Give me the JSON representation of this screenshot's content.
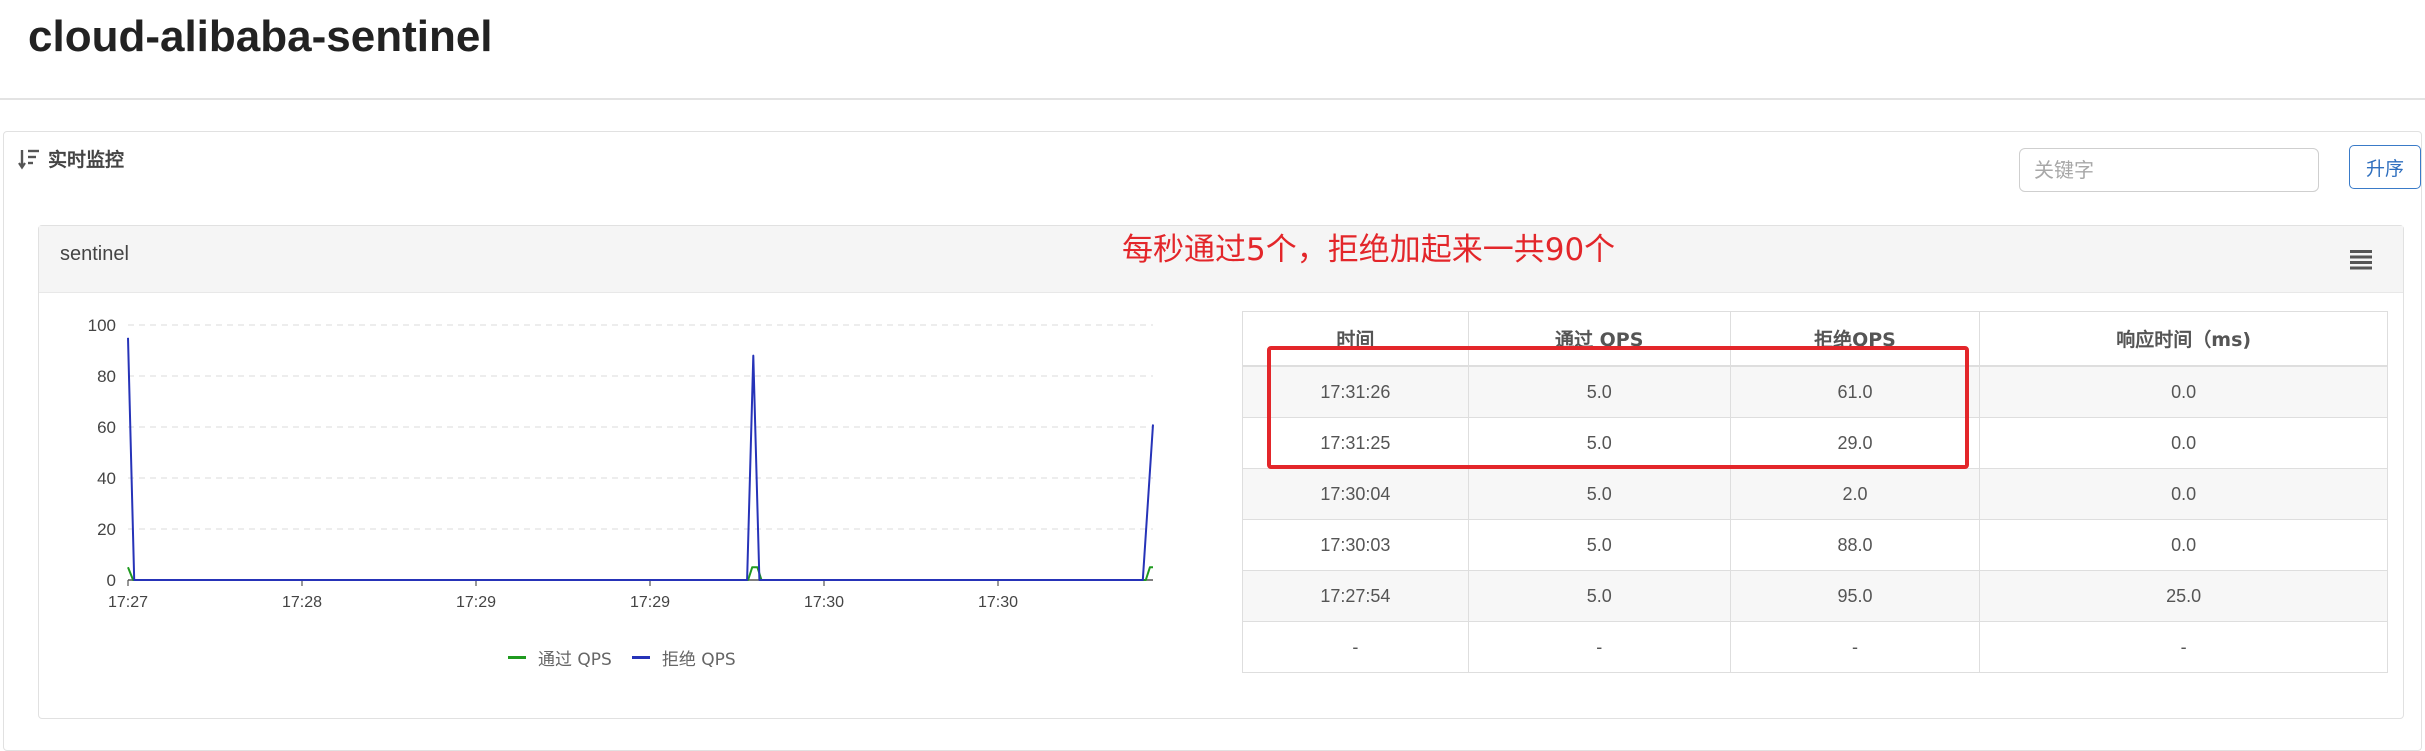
{
  "app": {
    "title": "cloud-alibaba-sentinel"
  },
  "section": {
    "title": "实时监控",
    "icon": "sort-descending-icon"
  },
  "search": {
    "placeholder": "关键字",
    "value": ""
  },
  "sort_button": {
    "label": "升序"
  },
  "card": {
    "title": "sentinel",
    "menu_icon": "list-menu-icon"
  },
  "annotation": {
    "text": "每秒通过5个，拒绝加起来一共90个",
    "color": "#e3262a"
  },
  "chart_data": {
    "type": "line",
    "x_labels": [
      "17:27",
      "17:28",
      "17:29",
      "17:29",
      "17:30",
      "17:30"
    ],
    "ylim": [
      0,
      100
    ],
    "y_ticks": [
      0,
      20,
      40,
      60,
      80,
      100
    ],
    "grid": true,
    "legend_placement": "bottom-center",
    "series": [
      {
        "name": "通过 QPS",
        "color": "#1f9a1f",
        "points": [
          [
            0.0,
            5
          ],
          [
            0.005,
            0
          ],
          [
            0.605,
            0
          ],
          [
            0.609,
            5
          ],
          [
            0.614,
            5
          ],
          [
            0.618,
            0
          ],
          [
            0.993,
            0
          ],
          [
            0.997,
            5
          ],
          [
            1.0,
            5
          ]
        ]
      },
      {
        "name": "拒绝 QPS",
        "color": "#2633b8",
        "points": [
          [
            0.0,
            95
          ],
          [
            0.006,
            0
          ],
          [
            0.604,
            0
          ],
          [
            0.61,
            88
          ],
          [
            0.616,
            0
          ],
          [
            0.99,
            0
          ],
          [
            1.0,
            61
          ]
        ]
      }
    ]
  },
  "table": {
    "columns": [
      "时间",
      "通过 QPS",
      "拒绝QPS",
      "响应时间（ms)"
    ],
    "rows": [
      [
        "17:31:26",
        "5.0",
        "61.0",
        "0.0"
      ],
      [
        "17:31:25",
        "5.0",
        "29.0",
        "0.0"
      ],
      [
        "17:30:04",
        "5.0",
        "2.0",
        "0.0"
      ],
      [
        "17:30:03",
        "5.0",
        "88.0",
        "0.0"
      ],
      [
        "17:27:54",
        "5.0",
        "95.0",
        "25.0"
      ],
      [
        "-",
        "-",
        "-",
        "-"
      ]
    ]
  }
}
